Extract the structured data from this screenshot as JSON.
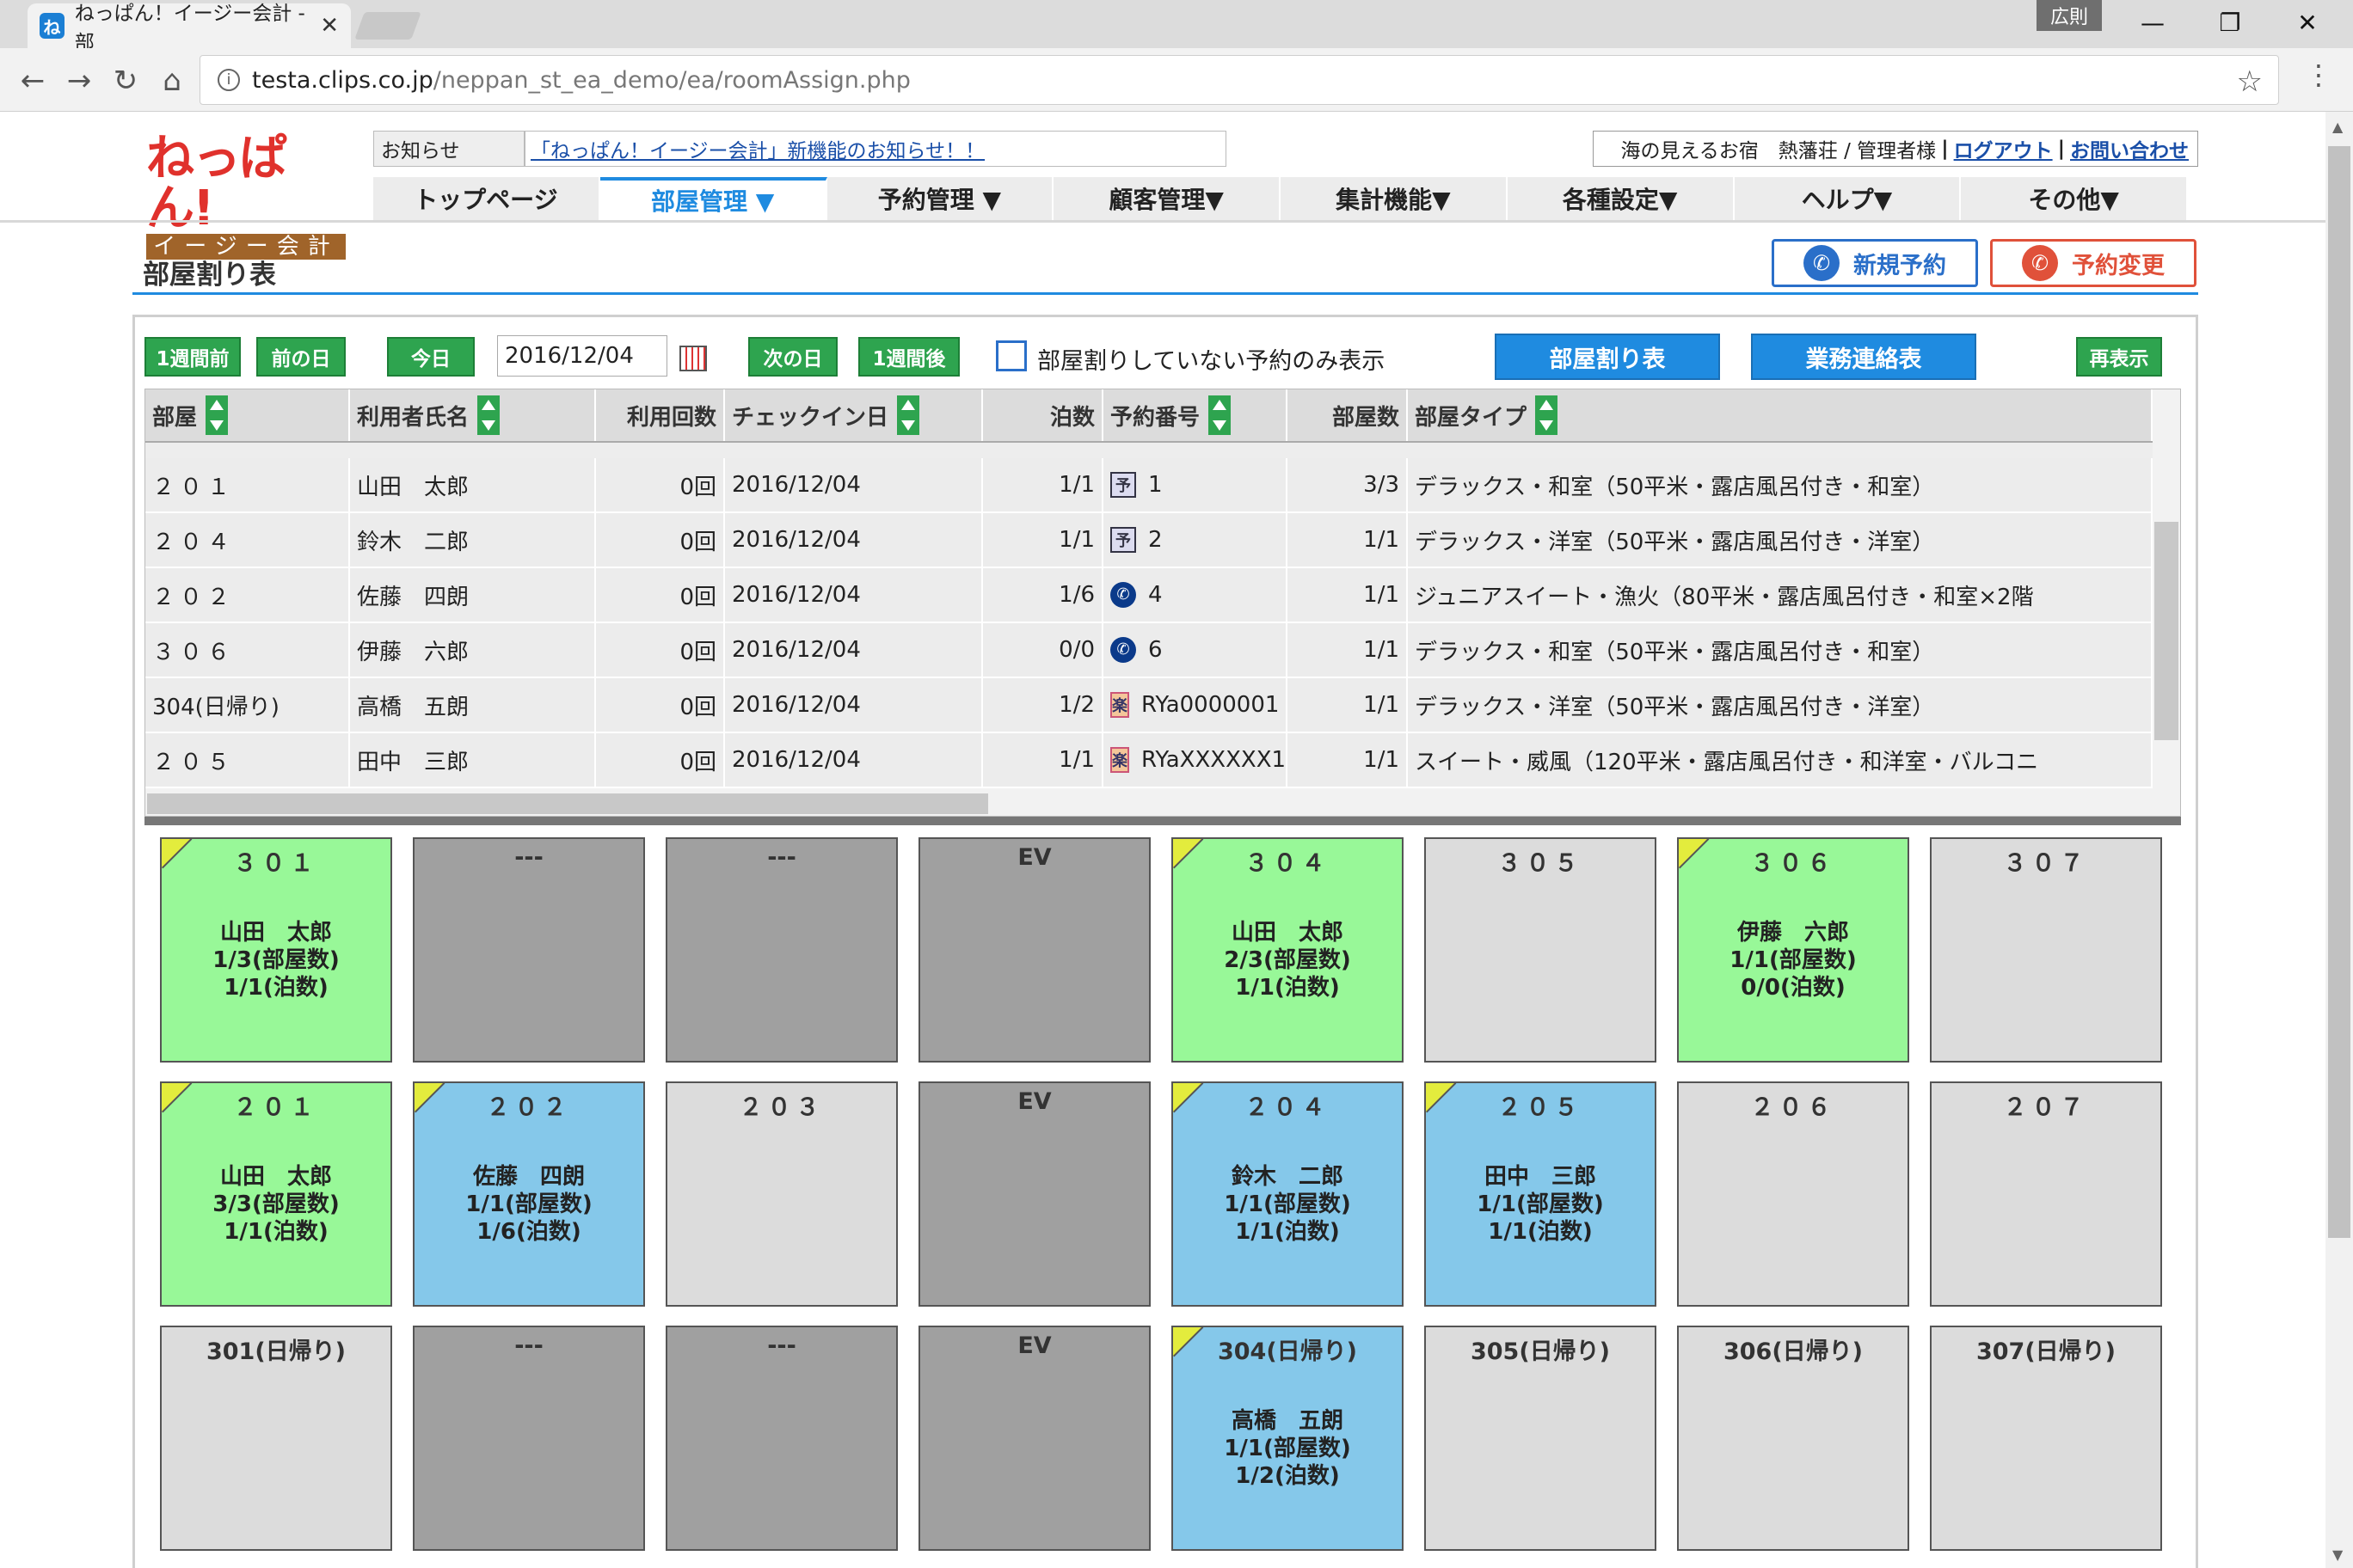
{
  "browser": {
    "tab_title": "ねっぱん！イージー会計 - 部",
    "url_domain": "testa.clips.co.jp",
    "url_path": "/neppan_st_ea_demo/ea/roomAssign.php",
    "user_badge": "広則"
  },
  "header": {
    "logo_top": "ねっぱん!",
    "logo_bottom": "イージー会計",
    "notice_label": "お知らせ",
    "notice_link": "「ねっぱん！イージー会計」新機能のお知らせ！！",
    "user_info": "海の見えるお宿　熱藩荘 / 管理者様",
    "logout": "ログアウト",
    "contact": "お問い合わせ"
  },
  "nav": [
    {
      "label": "トップページ",
      "active": false
    },
    {
      "label": "部屋管理 ▼",
      "active": true
    },
    {
      "label": "予約管理 ▼",
      "active": false
    },
    {
      "label": "顧客管理▼",
      "active": false
    },
    {
      "label": "集計機能▼",
      "active": false
    },
    {
      "label": "各種設定▼",
      "active": false
    },
    {
      "label": "ヘルプ▼",
      "active": false
    },
    {
      "label": "その他▼",
      "active": false
    }
  ],
  "page": {
    "title": "部屋割り表",
    "new_reservation": "新規予約",
    "change_reservation": "予約変更"
  },
  "toolbar": {
    "week_prev": "1週間前",
    "day_prev": "前の日",
    "today": "今日",
    "date": "2016/12/04",
    "day_next": "次の日",
    "week_next": "1週間後",
    "unassigned_only": "部屋割りしていない予約のみ表示",
    "room_chart": "部屋割り表",
    "work_contact": "業務連絡表",
    "refresh": "再表示"
  },
  "table": {
    "headers": [
      "部屋",
      "利用者氏名",
      "利用回数",
      "チェックイン日",
      "泊数",
      "予約番号",
      "部屋数",
      "部屋タイプ"
    ],
    "rows": [
      {
        "room": "２０１",
        "name": "山田　太郎",
        "visits": "0回",
        "checkin": "2016/12/04",
        "nights": "1/1",
        "src": "fax",
        "resno": "1",
        "rooms": "3/3",
        "type": "デラックス・和室（50平米・露店風呂付き・和室）"
      },
      {
        "room": "２０４",
        "name": "鈴木　二郎",
        "visits": "0回",
        "checkin": "2016/12/04",
        "nights": "1/1",
        "src": "fax",
        "resno": "2",
        "rooms": "1/1",
        "type": "デラックス・洋室（50平米・露店風呂付き・洋室）"
      },
      {
        "room": "２０２",
        "name": "佐藤　四朗",
        "visits": "0回",
        "checkin": "2016/12/04",
        "nights": "1/6",
        "src": "tel",
        "resno": "4",
        "rooms": "1/1",
        "type": "ジュニアスイート・漁火（80平米・露店風呂付き・和室×2階"
      },
      {
        "room": "３０６",
        "name": "伊藤　六郎",
        "visits": "0回",
        "checkin": "2016/12/04",
        "nights": "0/0",
        "src": "tel",
        "resno": "6",
        "rooms": "1/1",
        "type": "デラックス・和室（50平米・露店風呂付き・和室）"
      },
      {
        "room": "304(日帰り)",
        "name": "高橋　五朗",
        "visits": "0回",
        "checkin": "2016/12/04",
        "nights": "1/2",
        "src": "net",
        "resno": "RYa0000001",
        "rooms": "1/1",
        "type": "デラックス・洋室（50平米・露店風呂付き・洋室）"
      },
      {
        "room": "２０５",
        "name": "田中　三郎",
        "visits": "0回",
        "checkin": "2016/12/04",
        "nights": "1/1",
        "src": "net",
        "resno": "RYaXXXXXX1",
        "rooms": "1/1",
        "type": "スイート・威風（120平米・露店風呂付き・和洋室・バルコニ"
      }
    ]
  },
  "rooms": [
    {
      "no": "３０１",
      "color": "green",
      "corner": true,
      "lines": [
        "山田　太郎",
        "1/3(部屋数)",
        "1/1(泊数)"
      ]
    },
    {
      "no": "---",
      "color": "dark",
      "corner": false,
      "lines": []
    },
    {
      "no": "---",
      "color": "dark",
      "corner": false,
      "lines": []
    },
    {
      "no": "EV",
      "color": "dark",
      "corner": false,
      "lines": []
    },
    {
      "no": "３０４",
      "color": "green",
      "corner": true,
      "lines": [
        "山田　太郎",
        "2/3(部屋数)",
        "1/1(泊数)"
      ]
    },
    {
      "no": "３０５",
      "color": "light",
      "corner": false,
      "lines": []
    },
    {
      "no": "３０６",
      "color": "green",
      "corner": true,
      "lines": [
        "伊藤　六郎",
        "1/1(部屋数)",
        "0/0(泊数)"
      ]
    },
    {
      "no": "３０７",
      "color": "light",
      "corner": false,
      "lines": []
    },
    {
      "no": "２０１",
      "color": "green",
      "corner": true,
      "lines": [
        "山田　太郎",
        "3/3(部屋数)",
        "1/1(泊数)"
      ]
    },
    {
      "no": "２０２",
      "color": "blue",
      "corner": true,
      "lines": [
        "佐藤　四朗",
        "1/1(部屋数)",
        "1/6(泊数)"
      ]
    },
    {
      "no": "２０３",
      "color": "light",
      "corner": false,
      "lines": []
    },
    {
      "no": "EV",
      "color": "dark",
      "corner": false,
      "lines": []
    },
    {
      "no": "２０４",
      "color": "blue",
      "corner": true,
      "lines": [
        "鈴木　二郎",
        "1/1(部屋数)",
        "1/1(泊数)"
      ]
    },
    {
      "no": "２０５",
      "color": "blue",
      "corner": true,
      "lines": [
        "田中　三郎",
        "1/1(部屋数)",
        "1/1(泊数)"
      ]
    },
    {
      "no": "２０６",
      "color": "light",
      "corner": false,
      "lines": []
    },
    {
      "no": "２０７",
      "color": "light",
      "corner": false,
      "lines": []
    },
    {
      "no": "301(日帰り)",
      "color": "light",
      "corner": false,
      "lines": []
    },
    {
      "no": "---",
      "color": "dark",
      "corner": false,
      "lines": []
    },
    {
      "no": "---",
      "color": "dark",
      "corner": false,
      "lines": []
    },
    {
      "no": "EV",
      "color": "dark",
      "corner": false,
      "lines": []
    },
    {
      "no": "304(日帰り)",
      "color": "blue",
      "corner": true,
      "lines": [
        "高橋　五朗",
        "1/1(部屋数)",
        "1/2(泊数)"
      ]
    },
    {
      "no": "305(日帰り)",
      "color": "light",
      "corner": false,
      "lines": []
    },
    {
      "no": "306(日帰り)",
      "color": "light",
      "corner": false,
      "lines": []
    },
    {
      "no": "307(日帰り)",
      "color": "light",
      "corner": false,
      "lines": []
    }
  ]
}
